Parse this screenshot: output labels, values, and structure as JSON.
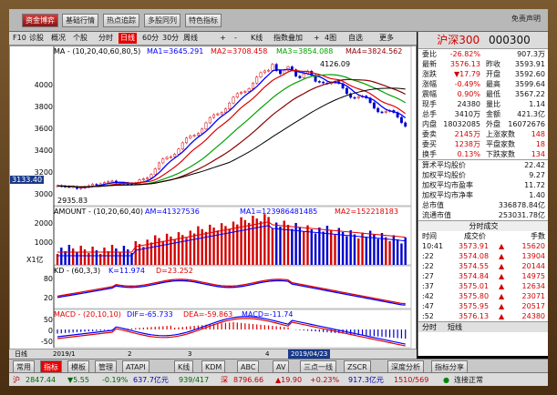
{
  "topmenu": {
    "buttons": [
      "资金博弈",
      "基础行情",
      "热点追踪",
      "多股同列",
      "特色指标"
    ],
    "right": "免责声明"
  },
  "toolbar": {
    "items": [
      "F10",
      "诊股",
      "概况",
      "个股",
      "分时",
      "日线",
      "60分",
      "30分",
      "周线",
      "+",
      "-",
      "K线",
      "指数叠加",
      "+",
      "4图",
      "自选",
      "更多"
    ],
    "active": "日线"
  },
  "instrument": {
    "name": "沪深300",
    "code": "000300"
  },
  "main_panel": {
    "ma_legend": {
      "title": "MA - (10,20,40,60,80,5)",
      "ma1": "MA1=3645.291",
      "ma2": "MA2=3708.458",
      "ma3": "MA3=3854.088",
      "ma4": "MA4=3824.562"
    },
    "high_label": "4126.09",
    "low_label": "2935.83",
    "cursor_price": "3133.40",
    "y_ticks": [
      "4000",
      "3800",
      "3600",
      "3400",
      "3200",
      "3000"
    ]
  },
  "amount_panel": {
    "legend": "AMOUNT - (10,20,60,40)",
    "am": "AM=41327536",
    "ma1": "MA1=123986481485",
    "ma2": "MA2=152218183",
    "y_ticks": [
      "2000",
      "1000"
    ],
    "unit": "X1亿"
  },
  "kd_panel": {
    "legend": "KD - (60,3,3)",
    "k": "K=11.974",
    "d": "D=23.252",
    "y_ticks": [
      "80",
      "20"
    ]
  },
  "macd_panel": {
    "legend": "MACD - (20,10,10)",
    "dif": "DIF=-65.733",
    "dea": "DEA=-59.863",
    "macd": "MACD=-11.74",
    "y_ticks": [
      "50",
      "0",
      "-50"
    ]
  },
  "date_axis": {
    "labels": [
      "日线",
      "2019/1",
      "2",
      "3",
      "4"
    ],
    "cursor_date": "2019/04/23"
  },
  "quote": {
    "rows": [
      {
        "l1": "委比",
        "v1": "-26.82%",
        "l2": "",
        "v2": "907.3万"
      },
      {
        "l1": "最新",
        "v1": "3576.13",
        "l2": "昨收",
        "v2": "3593.91"
      },
      {
        "l1": "涨跌",
        "v1": "▼17.79",
        "l2": "开盘",
        "v2": "3592.60"
      },
      {
        "l1": "涨幅",
        "v1": "-0.49%",
        "l2": "最高",
        "v2": "3599.64"
      },
      {
        "l1": "震幅",
        "v1": "0.90%",
        "l2": "最低",
        "v2": "3567.22"
      },
      {
        "l1": "现手",
        "v1": "24380",
        "l2": "量比",
        "v2": "1.14"
      },
      {
        "l1": "总手",
        "v1": "3410万",
        "l2": "金额",
        "v2": "421.3亿"
      },
      {
        "l1": "内盘",
        "v1": "18032085",
        "l2": "外盘",
        "v2": "16072676"
      },
      {
        "l1": "委卖",
        "v1": "2145万",
        "l2": "上涨家数",
        "v2": "148"
      },
      {
        "l1": "委买",
        "v1": "1238万",
        "l2": "平盘家数",
        "v2": "18"
      },
      {
        "l1": "换手",
        "v1": "0.13%",
        "l2": "下跌家数",
        "v2": "134"
      }
    ],
    "stats": [
      {
        "label": "算术平均股价",
        "value": "22.42"
      },
      {
        "label": "加权平均股价",
        "value": "9.27"
      },
      {
        "label": "加权平均市盈率",
        "value": "11.72"
      },
      {
        "label": "加权平均市净率",
        "value": "1.40"
      },
      {
        "label": "总市值",
        "value": "336878.84亿"
      },
      {
        "label": "流通市值",
        "value": "253031.78亿"
      }
    ],
    "ticks_header": {
      "title": "分时成交",
      "c1": "时间",
      "c2": "成交价",
      "c3": "手数"
    },
    "ticks": [
      {
        "t": "10:41",
        "p": "3573.91",
        "d": "▲",
        "v": "15620"
      },
      {
        "t": ":22",
        "p": "3574.08",
        "d": "▲",
        "v": "13904"
      },
      {
        "t": ":22",
        "p": "3574.55",
        "d": "▲",
        "v": "20144"
      },
      {
        "t": ":27",
        "p": "3574.84",
        "d": "▲",
        "v": "14975"
      },
      {
        "t": ":37",
        "p": "3575.01",
        "d": "▲",
        "v": "12634"
      },
      {
        "t": ":42",
        "p": "3575.80",
        "d": "▲",
        "v": "23071"
      },
      {
        "t": ":47",
        "p": "3575.95",
        "d": "▲",
        "v": "20517"
      },
      {
        "t": ":52",
        "p": "3576.13",
        "d": "▲",
        "v": "24380"
      }
    ],
    "tabs": [
      "分时",
      "短线"
    ]
  },
  "panel_tabs": [
    "常用",
    "指标",
    "模板",
    "管理",
    "ATAPI",
    "K线",
    "KDM",
    "ABC",
    "AV",
    "三点一线",
    "ZSCR",
    "深度分析",
    "指标分享"
  ],
  "status": {
    "sh": {
      "name": "沪",
      "val": "2847.44",
      "chg": "▼5.55",
      "pct": "-0.19%",
      "amt": "637.7亿元",
      "ud": "939/417"
    },
    "sz": {
      "name": "深",
      "val": "8796.66",
      "chg": "▲19.90",
      "pct": "+0.23%",
      "amt": "917.3亿元",
      "ud": "1510/569"
    },
    "conn": "连接正常"
  },
  "colors": {
    "up": "#d40000",
    "down": "#0000cc",
    "ma1": "#0000ff",
    "ma2": "#e00000",
    "ma3": "#00a000",
    "ma4": "#8b0000",
    "ma5": "#000000"
  }
}
